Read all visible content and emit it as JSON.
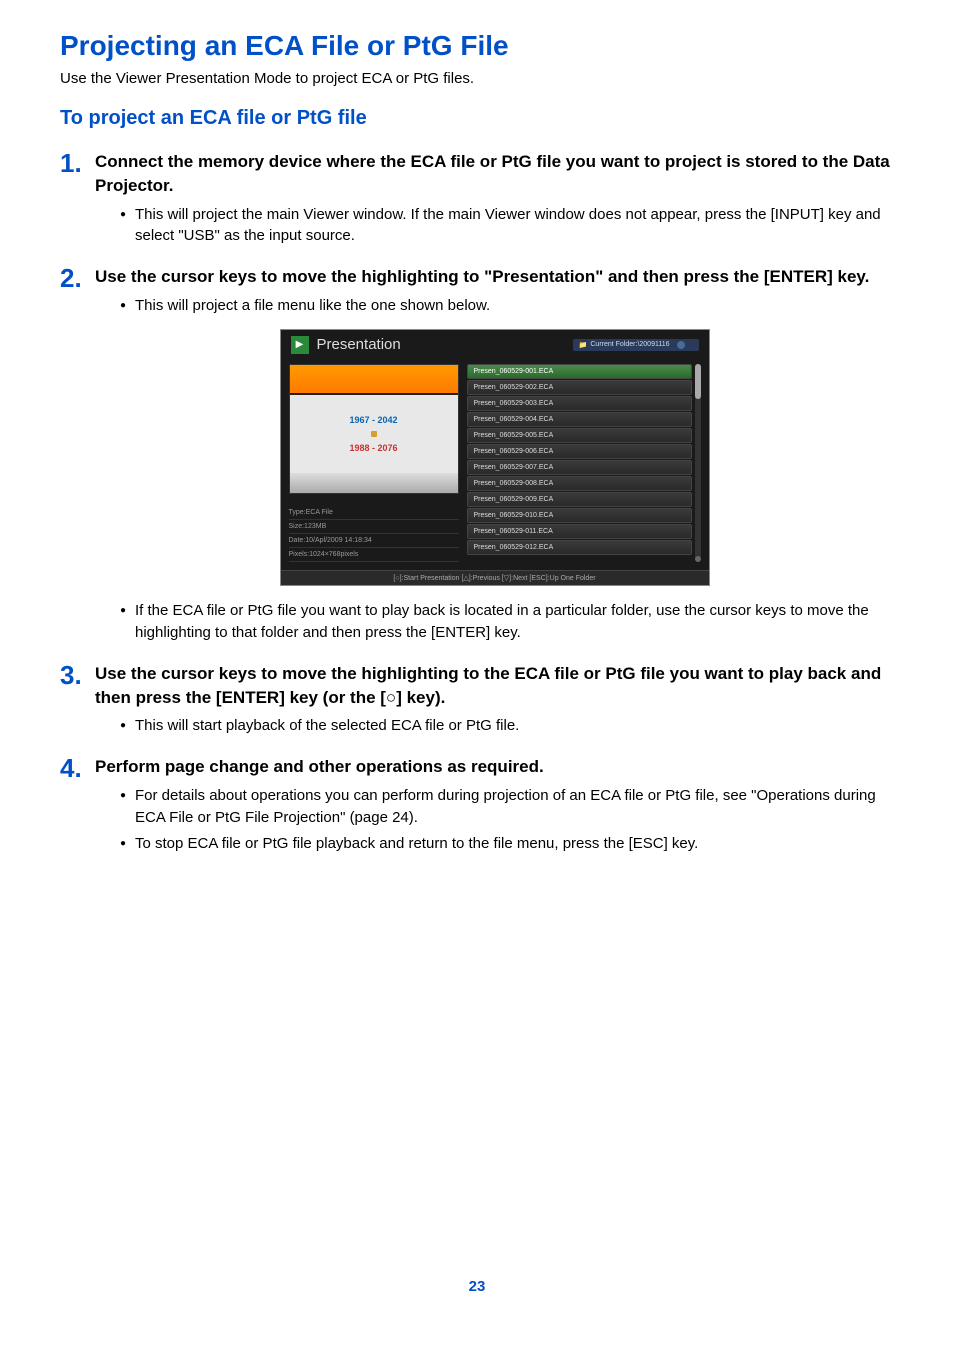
{
  "mainTitle": "Projecting an ECA File or PtG File",
  "intro": "Use the Viewer Presentation Mode to project ECA or PtG files.",
  "subTitle": "To project an ECA file or PtG file",
  "steps": [
    {
      "num": "1.",
      "heading": "Connect the memory device where the ECA file or PtG file you want to project is stored to the Data Projector.",
      "bullets": [
        "This will project the main Viewer window. If the main Viewer window does not appear, press the [INPUT] key and select \"USB\" as the input source."
      ]
    },
    {
      "num": "2.",
      "heading": "Use the cursor keys to move the highlighting to \"Presentation\" and then press the [ENTER] key.",
      "bullets": [
        "This will project a file menu like the one shown below."
      ],
      "afterBullets": [
        "If the ECA file or PtG file you want to play back is located in a particular folder, use the cursor keys to move the highlighting to that folder and then press the [ENTER] key."
      ]
    },
    {
      "num": "3.",
      "heading": "Use the cursor keys to move the highlighting to the ECA file or PtG file you want to play back and then press the [ENTER] key (or the [○] key).",
      "bullets": [
        "This will start playback of the selected ECA file or PtG file."
      ]
    },
    {
      "num": "4.",
      "heading": "Perform page change and other operations as required.",
      "bullets": [
        "For details about operations you can perform during projection of an ECA file or PtG file, see \"Operations during ECA File or PtG File Projection\" (page 24).",
        "To stop ECA file or PtG file playback and return to the file menu, press the [ESC] key."
      ]
    }
  ],
  "screenshot": {
    "title": "Presentation",
    "folderBadge": "Current Folder:\\20091116",
    "preview": {
      "y1": "1967 - 2042",
      "y2": "1988 - 2076"
    },
    "meta": {
      "type": "Type:ECA File",
      "size": "Size:123MB",
      "date": "Date:10/Apl/2009 14:18:34",
      "pixels": "Pixels:1024×768pixels"
    },
    "files": [
      "Presen_060529-001.ECA",
      "Presen_060529-002.ECA",
      "Presen_060529-003.ECA",
      "Presen_060529-004.ECA",
      "Presen_060529-005.ECA",
      "Presen_060529-006.ECA",
      "Presen_060529-007.ECA",
      "Presen_060529-008.ECA",
      "Presen_060529-009.ECA",
      "Presen_060529-010.ECA",
      "Presen_060529-011.ECA",
      "Presen_060529-012.ECA"
    ],
    "footer": "[○]:Start Presentation  [△]:Previous  [▽]:Next  [ESC]:Up One Folder"
  },
  "pageNumber": "23"
}
